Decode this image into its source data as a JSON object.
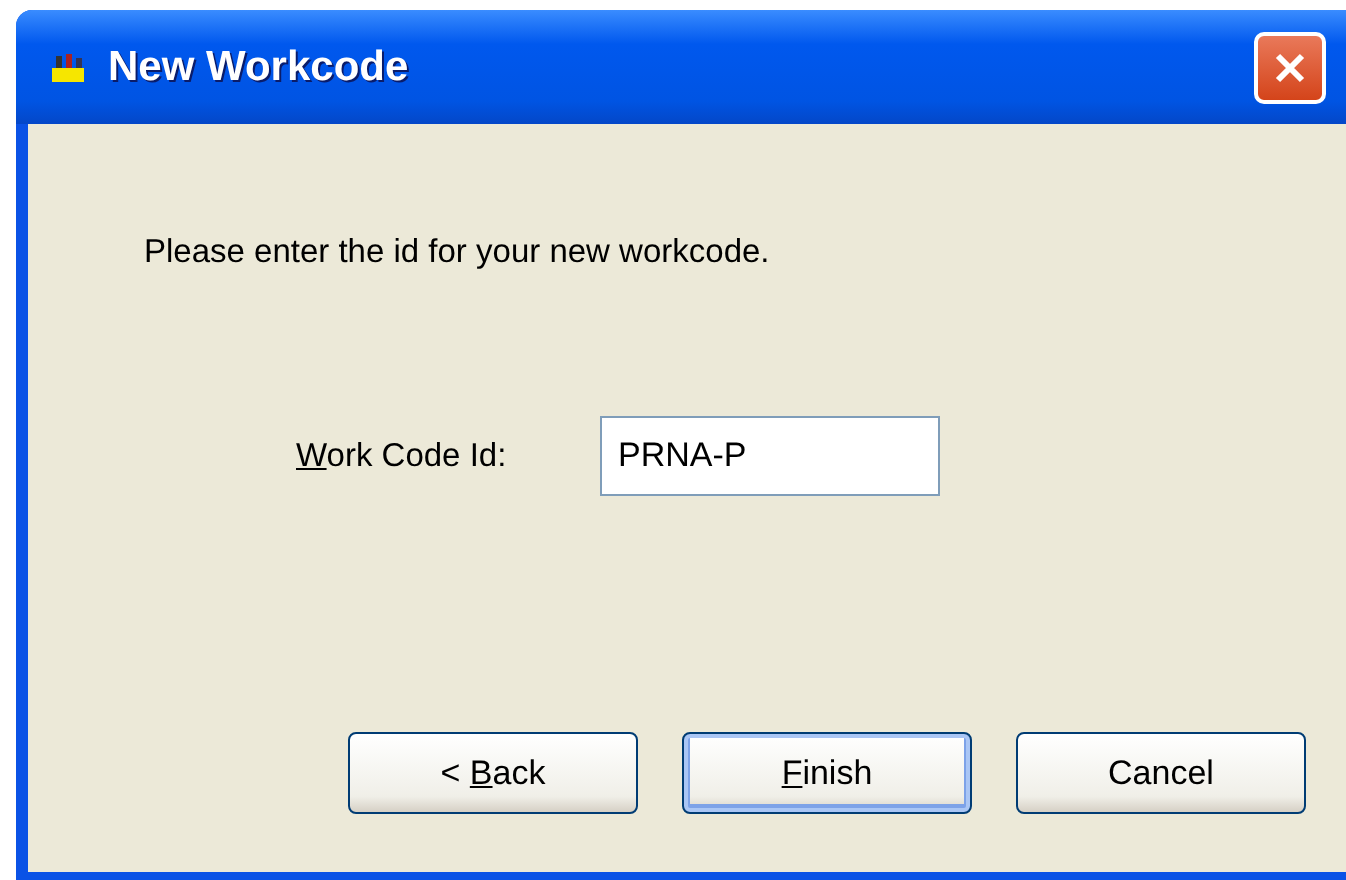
{
  "window": {
    "title": "New Workcode"
  },
  "prompt": "Please enter the id for your new workcode.",
  "field": {
    "label": "Work Code Id:",
    "access_key": true,
    "value": "PRNA-P"
  },
  "buttons": [
    {
      "label": "< Back",
      "access_key": true,
      "default": false
    },
    {
      "label": "Finish",
      "access_key": true,
      "default": true
    },
    {
      "label": "Cancel",
      "access_key": false,
      "default": false
    }
  ]
}
